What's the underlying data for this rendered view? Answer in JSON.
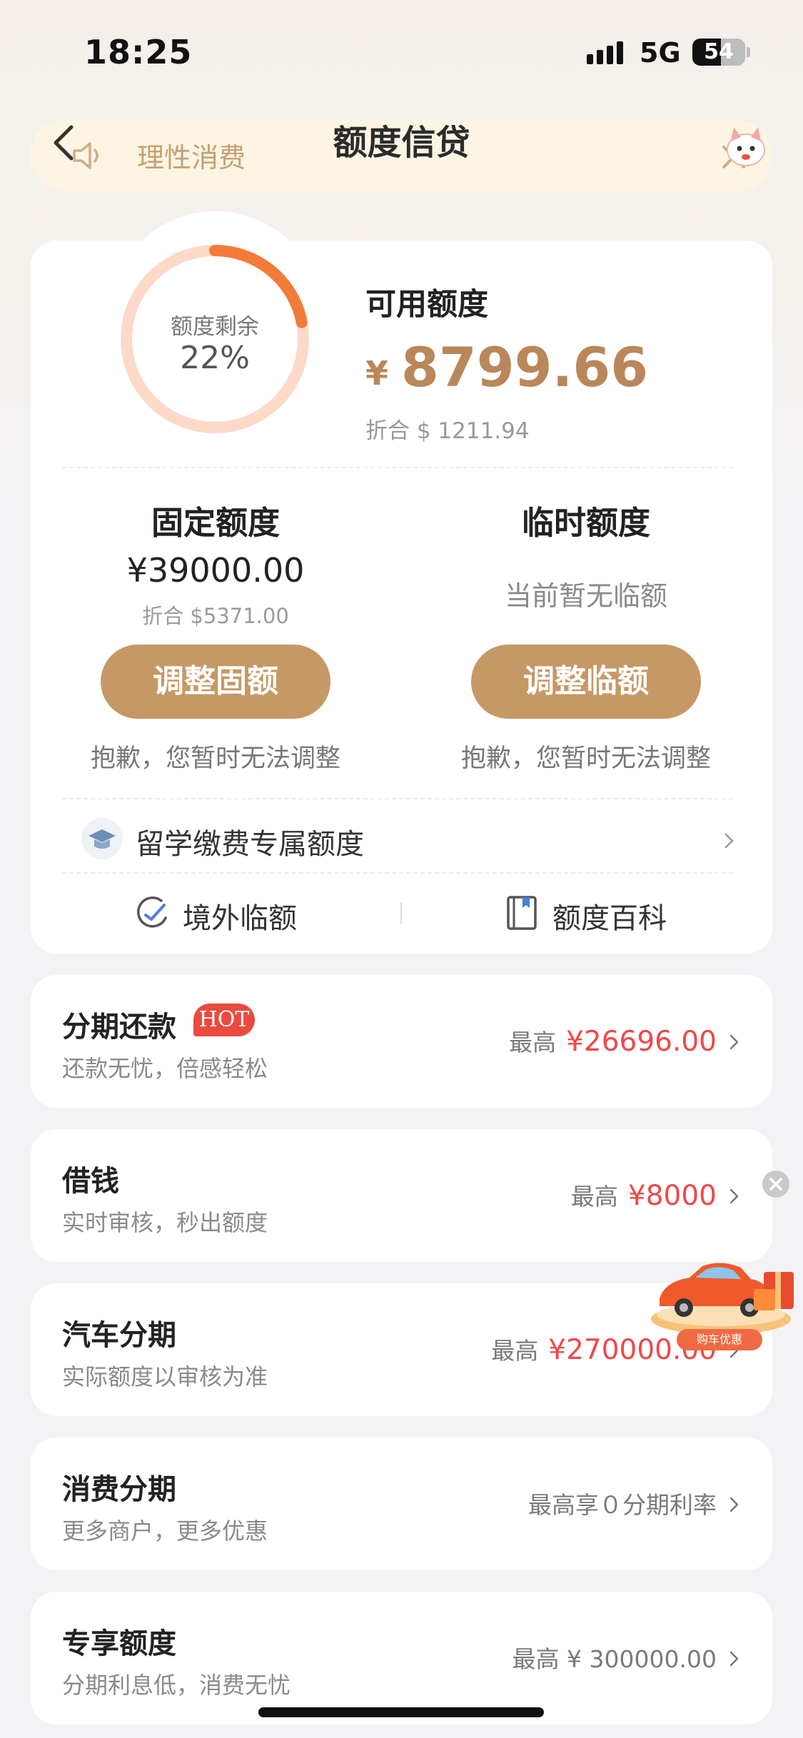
{
  "status_bar": {
    "time": "18:25",
    "network": "5G",
    "battery": "54",
    "battery_level_percent": 54
  },
  "header": {
    "title": "额度信贷",
    "notice_text": "理性消费"
  },
  "quota_summary": {
    "remaining_label": "额度剩余",
    "remaining_percent_text": "22%",
    "remaining_fraction": 0.22,
    "available_label": "可用额度",
    "currency_symbol": "¥",
    "available_amount": "8799.66",
    "available_converted": "折合 $ 1211.94"
  },
  "fixed_quota": {
    "title": "固定额度",
    "amount": "¥39000.00",
    "converted": "折合 $5371.00",
    "button_label": "调整固额",
    "note": "抱歉，您暂时无法调整"
  },
  "temp_quota": {
    "title": "临时额度",
    "status": "当前暂无临额",
    "button_label": "调整临额",
    "note": "抱歉，您暂时无法调整"
  },
  "study_abroad": {
    "label": "留学缴费专属额度"
  },
  "links": {
    "overseas": "境外临额",
    "encyclopedia": "额度百科"
  },
  "products": [
    {
      "title": "分期还款",
      "badge": "HOT",
      "subtitle": "还款无忧，倍感轻松",
      "prefix": "最高",
      "amount": "¥26696.00"
    },
    {
      "title": "借钱",
      "subtitle": "实时审核，秒出额度",
      "prefix": "最高",
      "amount": "¥8000"
    },
    {
      "title": "汽车分期",
      "subtitle": "实际额度以审核为准",
      "prefix": "最高",
      "amount": "¥270000.00"
    },
    {
      "title": "消费分期",
      "subtitle": "更多商户，更多优惠",
      "prefix": "最高享０分期利率",
      "amount": ""
    },
    {
      "title": "专享额度",
      "subtitle": "分期利息低，消费无忧",
      "prefix": "最高 ¥ 300000.00",
      "amount": ""
    }
  ],
  "promo": {
    "label": "购车优惠"
  },
  "colors": {
    "accent_gold": "#c69865",
    "amount_gold": "#b9875a",
    "ring_orange": "#f47a3a",
    "ring_track": "#fdd9c8",
    "price_red": "#f04848"
  }
}
